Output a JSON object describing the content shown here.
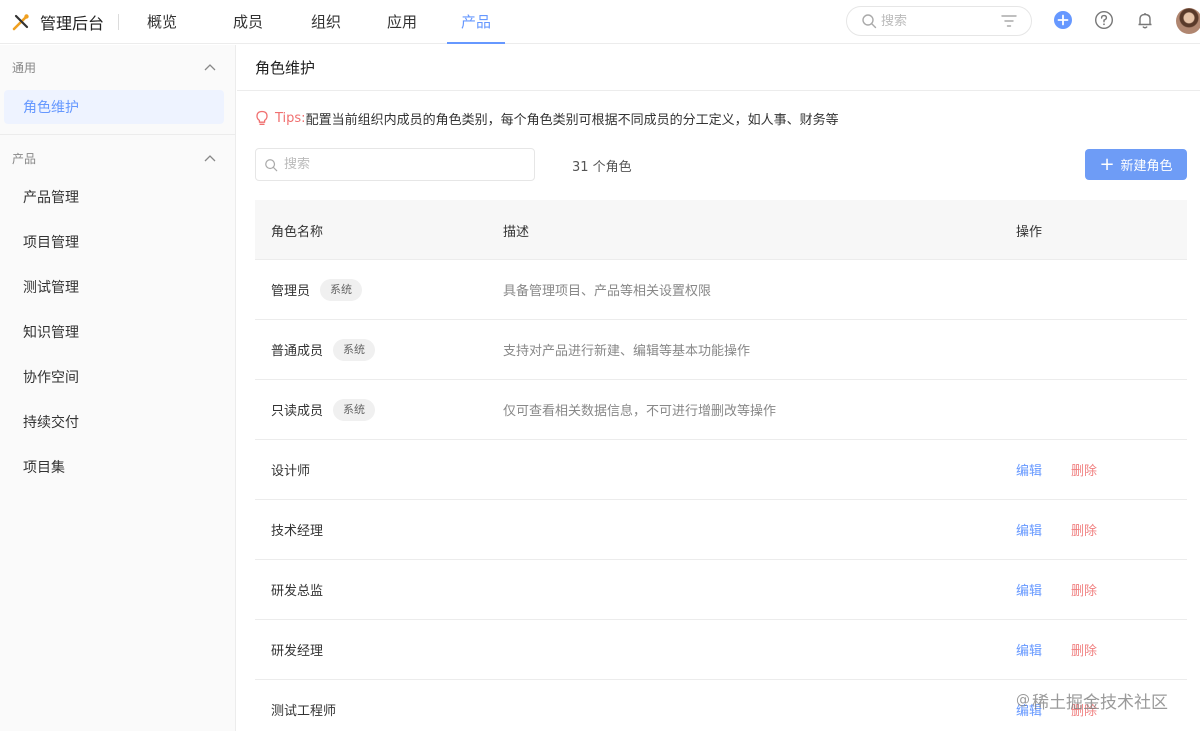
{
  "header": {
    "app_title": "管理后台",
    "nav": [
      {
        "label": "概览",
        "active": false
      },
      {
        "label": "成员",
        "active": false
      },
      {
        "label": "组织",
        "active": false
      },
      {
        "label": "应用",
        "active": false
      },
      {
        "label": "产品",
        "active": true
      }
    ],
    "search_placeholder": "搜索"
  },
  "sidebar": {
    "groups": [
      {
        "title": "通用",
        "items": [
          {
            "label": "角色维护",
            "active": true
          }
        ]
      },
      {
        "title": "产品",
        "items": [
          {
            "label": "产品管理",
            "active": false
          },
          {
            "label": "项目管理",
            "active": false
          },
          {
            "label": "测试管理",
            "active": false
          },
          {
            "label": "知识管理",
            "active": false
          },
          {
            "label": "协作空间",
            "active": false
          },
          {
            "label": "持续交付",
            "active": false
          },
          {
            "label": "项目集",
            "active": false
          }
        ]
      }
    ]
  },
  "main": {
    "title": "角色维护",
    "tips_label": "Tips:",
    "tips_text": "配置当前组织内成员的角色类别，每个角色类别可根据不同成员的分工定义，如人事、财务等",
    "search_placeholder": "搜索",
    "count_text": "31 个角色",
    "new_button_label": "新建角色",
    "table": {
      "columns": [
        "角色名称",
        "描述",
        "操作"
      ],
      "rows": [
        {
          "name": "管理员",
          "badge": "系统",
          "desc": "具备管理项目、产品等相关设置权限",
          "edit": "",
          "delete": ""
        },
        {
          "name": "普通成员",
          "badge": "系统",
          "desc": "支持对产品进行新建、编辑等基本功能操作",
          "edit": "",
          "delete": ""
        },
        {
          "name": "只读成员",
          "badge": "系统",
          "desc": "仅可查看相关数据信息，不可进行增删改等操作",
          "edit": "",
          "delete": ""
        },
        {
          "name": "设计师",
          "badge": "",
          "desc": "",
          "edit": "编辑",
          "delete": "删除"
        },
        {
          "name": "技术经理",
          "badge": "",
          "desc": "",
          "edit": "编辑",
          "delete": "删除"
        },
        {
          "name": "研发总监",
          "badge": "",
          "desc": "",
          "edit": "编辑",
          "delete": "删除"
        },
        {
          "name": "研发经理",
          "badge": "",
          "desc": "",
          "edit": "编辑",
          "delete": "删除"
        },
        {
          "name": "测试工程师",
          "badge": "",
          "desc": "",
          "edit": "编辑",
          "delete": "删除"
        }
      ]
    }
  },
  "watermark": {
    "text": "稀土掘金技术社区",
    "at": "@"
  },
  "colors": {
    "accent": "#6698ff",
    "button": "#6e9cf6",
    "danger": "#f08080",
    "tips": "#f07070"
  },
  "icons": [
    "logo-icon",
    "search-icon",
    "filter-icon",
    "add-circle-icon",
    "help-icon",
    "bell-icon",
    "chevron-up-icon",
    "bulb-icon",
    "plus-icon"
  ]
}
